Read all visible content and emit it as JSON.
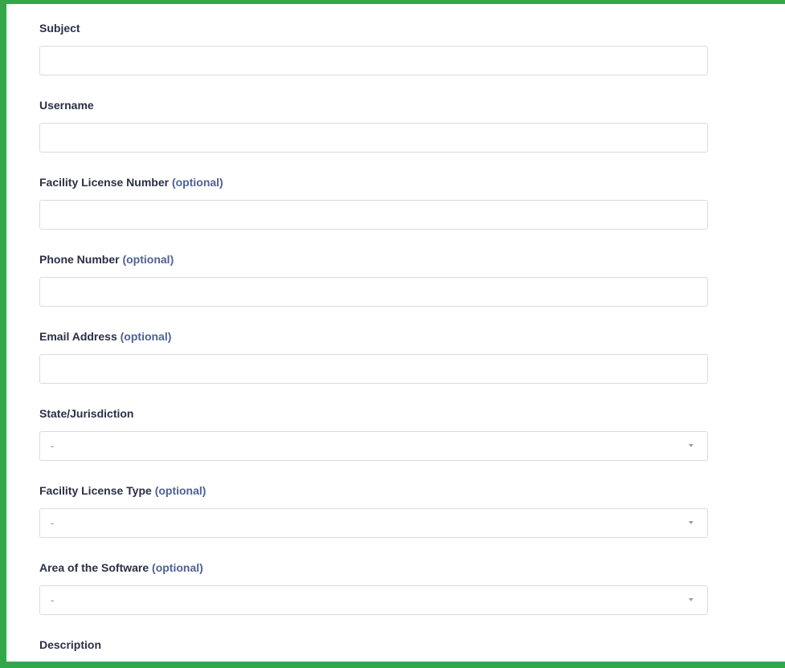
{
  "form": {
    "subject": {
      "label": "Subject",
      "value": ""
    },
    "username": {
      "label": "Username",
      "value": ""
    },
    "facility_license_number": {
      "label": "Facility License Number",
      "optional": "(optional)",
      "value": ""
    },
    "phone_number": {
      "label": "Phone Number",
      "optional": "(optional)",
      "value": ""
    },
    "email_address": {
      "label": "Email Address",
      "optional": "(optional)",
      "value": ""
    },
    "state_jurisdiction": {
      "label": "State/Jurisdiction",
      "selected": "-"
    },
    "facility_license_type": {
      "label": "Facility License Type",
      "optional": "(optional)",
      "selected": "-"
    },
    "area_of_software": {
      "label": "Area of the Software",
      "optional": "(optional)",
      "selected": "-"
    },
    "description": {
      "label": "Description"
    }
  },
  "colors": {
    "frame_border": "#32a84a",
    "label_text": "#2a2f45",
    "optional_text": "#4f6193",
    "input_border": "#d9dbe0"
  },
  "icons": {
    "select_caret": "chevron-down-icon"
  }
}
